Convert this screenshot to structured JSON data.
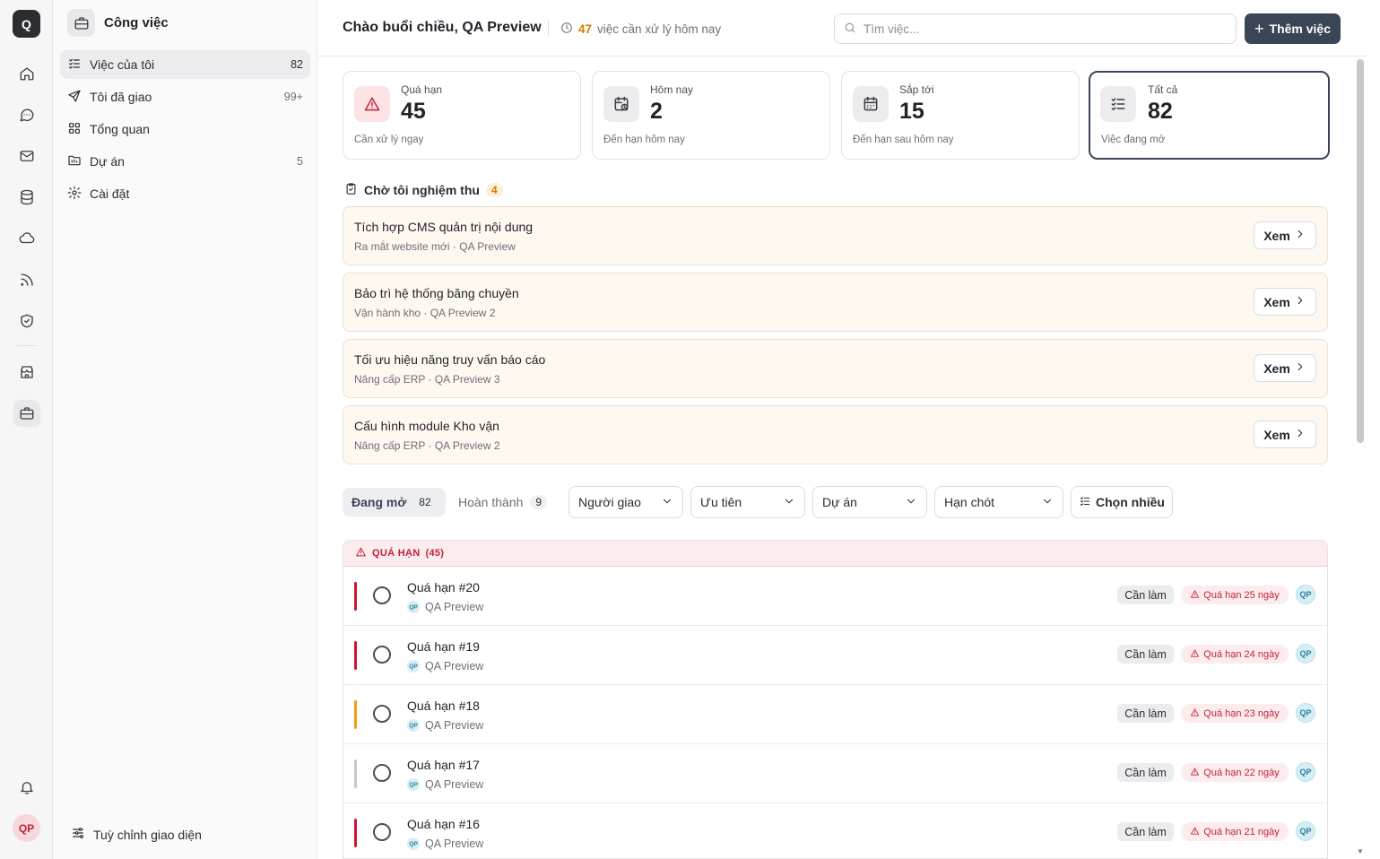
{
  "rail": {
    "logo": "Q",
    "avatar": "QP",
    "icons": [
      "home-icon",
      "chat-icon",
      "mail-icon",
      "database-icon",
      "cloud-icon",
      "feed-icon",
      "shield-icon",
      "store-icon",
      "briefcase-icon",
      "bell-icon"
    ]
  },
  "nav": {
    "title": "Công việc",
    "items": [
      {
        "label": "Việc của tôi",
        "count": "82"
      },
      {
        "label": "Tôi đã giao",
        "count": "99+"
      },
      {
        "label": "Tổng quan",
        "count": ""
      },
      {
        "label": "Dự án",
        "count": "5"
      },
      {
        "label": "Cài đặt",
        "count": ""
      }
    ],
    "footer": "Tuỳ chỉnh giao diện"
  },
  "header": {
    "greeting": "Chào buổi chiều, QA Preview",
    "todo_count": "47",
    "todo_text": "việc cần xử lý hôm nay",
    "search_placeholder": "Tìm việc...",
    "add_label": "Thêm việc"
  },
  "stats": [
    {
      "label": "Quá hạn",
      "value": "45",
      "desc": "Cần xử lý ngay",
      "icon": "warning-icon"
    },
    {
      "label": "Hôm nay",
      "value": "2",
      "desc": "Đến hạn hôm nay",
      "icon": "calendar-clock-icon"
    },
    {
      "label": "Sắp tới",
      "value": "15",
      "desc": "Đến hạn sau hôm nay",
      "icon": "calendar-icon"
    },
    {
      "label": "Tất cả",
      "value": "82",
      "desc": "Việc đang mở",
      "icon": "checklist-icon"
    }
  ],
  "waiting": {
    "title": "Chờ tôi nghiệm thu",
    "count": "4",
    "view_label": "Xem",
    "items": [
      {
        "title": "Tích hợp CMS quản trị nội dung",
        "sub": "Ra mắt website mới · QA Preview"
      },
      {
        "title": "Bảo trì hệ thống băng chuyền",
        "sub": "Vận hành kho · QA Preview 2"
      },
      {
        "title": "Tối ưu hiệu năng truy vấn báo cáo",
        "sub": "Nâng cấp ERP · QA Preview 3"
      },
      {
        "title": "Cấu hình module Kho vận",
        "sub": "Nâng cấp ERP · QA Preview 2"
      }
    ]
  },
  "filters": {
    "tab_open": "Đang mở",
    "tab_open_count": "82",
    "tab_done": "Hoàn thành",
    "tab_done_count": "9",
    "assigner": "Người giao",
    "priority": "Ưu tiên",
    "project": "Dự án",
    "deadline": "Hạn chót",
    "multi": "Chọn nhiều"
  },
  "list": {
    "group_label": "QUÁ HẠN",
    "group_count": "(45)",
    "rows": [
      {
        "title": "Quá hạn #20",
        "project": "QA Preview",
        "mini": "QP",
        "status": "Cần làm",
        "overdue": "Quá hạn 25 ngày",
        "assignee": "QP",
        "priority_color": "#d0142c"
      },
      {
        "title": "Quá hạn #19",
        "project": "QA Preview",
        "mini": "QP",
        "status": "Cần làm",
        "overdue": "Quá hạn 24 ngày",
        "assignee": "QP",
        "priority_color": "#d0142c"
      },
      {
        "title": "Quá hạn #18",
        "project": "QA Preview",
        "mini": "QP",
        "status": "Cần làm",
        "overdue": "Quá hạn 23 ngày",
        "assignee": "QP",
        "priority_color": "#f59e0b"
      },
      {
        "title": "Quá hạn #17",
        "project": "QA Preview",
        "mini": "QP",
        "status": "Cần làm",
        "overdue": "Quá hạn 22 ngày",
        "assignee": "QP",
        "priority_color": "#c8c8cc"
      },
      {
        "title": "Quá hạn #16",
        "project": "QA Preview",
        "mini": "QP",
        "status": "Cần làm",
        "overdue": "Quá hạn 21 ngày",
        "assignee": "QP",
        "priority_color": "#d0142c"
      }
    ]
  },
  "colors": {
    "accent": "#3a4556",
    "danger": "#c0223a",
    "warning": "#d97706"
  }
}
